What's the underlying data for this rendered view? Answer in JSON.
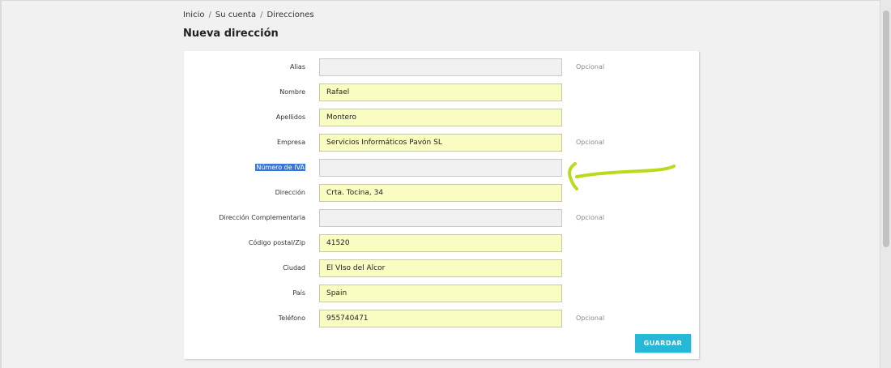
{
  "breadcrumb": {
    "items": [
      "Inicio",
      "Su cuenta",
      "Direcciones"
    ],
    "separator": "/"
  },
  "page_title": "Nueva dirección",
  "form": {
    "fields": [
      {
        "label": "Alias",
        "value": "",
        "optional": "Opcional"
      },
      {
        "label": "Nombre",
        "value": "Rafael",
        "optional": ""
      },
      {
        "label": "Apellidos",
        "value": "Montero",
        "optional": ""
      },
      {
        "label": "Empresa",
        "value": "Servicios Informáticos Pavón SL",
        "optional": "Opcional"
      },
      {
        "label": "Número de IVA",
        "value": "",
        "optional": ""
      },
      {
        "label": "Dirección",
        "value": "Crta. Tocina, 34",
        "optional": ""
      },
      {
        "label": "Dirección Complementaria",
        "value": "",
        "optional": "Opcional"
      },
      {
        "label": "Código postal/Zip",
        "value": "41520",
        "optional": ""
      },
      {
        "label": "Ciudad",
        "value": "El VIso del Alcor",
        "optional": ""
      },
      {
        "label": "País",
        "value": "Spain",
        "optional": ""
      },
      {
        "label": "Teléfono",
        "value": "955740471",
        "optional": "Opcional"
      }
    ],
    "save_label": "GUARDAR"
  },
  "colors": {
    "accent": "#25b9d7",
    "autofill_bg": "#fafdc2",
    "empty_bg": "#f1f1f1",
    "selection": "#3a76d6",
    "annotation": "#b8dc1c"
  },
  "icons": {
    "annotation": "hand-drawn-arrow-icon"
  }
}
